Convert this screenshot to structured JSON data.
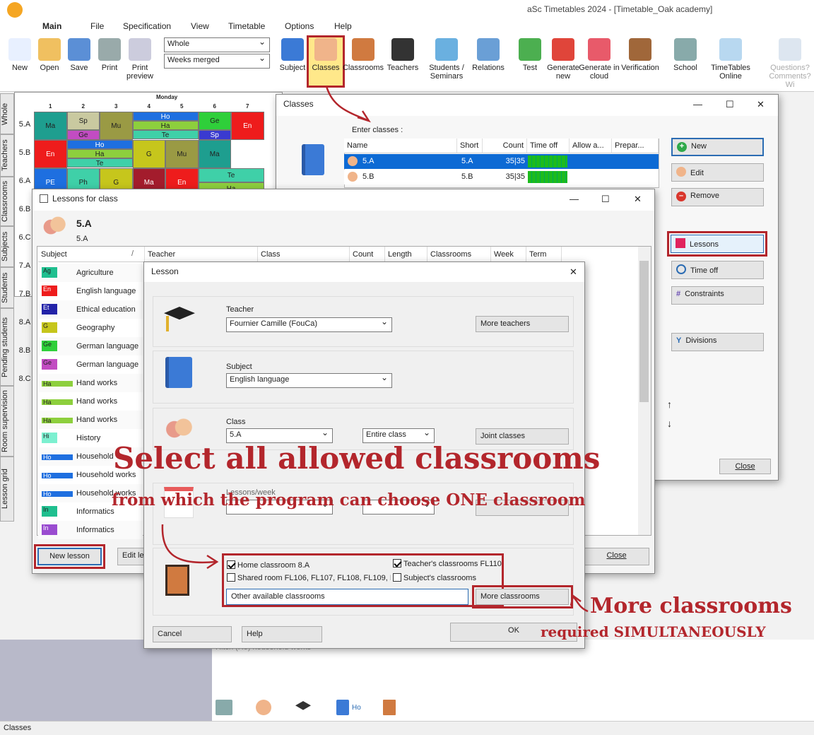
{
  "app": {
    "title": "aSc Timetables 2024 - [Timetable_Oak academy]",
    "statusbar": "Classes",
    "colors": {
      "accent": "#2b6cb3",
      "highlight": "#b3262c"
    }
  },
  "menu": [
    "Main",
    "File",
    "Specification",
    "View",
    "Timetable",
    "Options",
    "Help"
  ],
  "toolbar": {
    "new": "New",
    "open": "Open",
    "save": "Save",
    "print": "Print",
    "print_preview": "Print preview",
    "view_select": "Whole",
    "weeks_select": "Weeks merged",
    "subject": "Subject",
    "classes": "Classes",
    "classrooms": "Classrooms",
    "teachers": "Teachers",
    "students": "Students / Seminars",
    "relations": "Relations",
    "test": "Test",
    "generate_new": "Generate new",
    "generate_cloud": "Generate in cloud",
    "verification": "Verification",
    "school": "School",
    "timetables_online": "TimeTables Online",
    "questions": "Questions? Comments? Wi"
  },
  "side_tabs": [
    "Whole",
    "Teachers",
    "Classrooms",
    "Subjects",
    "Students",
    "Pending students",
    "Room supervision",
    "Lesson grid"
  ],
  "grid": {
    "day": "Monday",
    "periods": [
      "1",
      "2",
      "3",
      "4",
      "5",
      "6",
      "7"
    ],
    "rows": [
      "5.A",
      "5.B",
      "6.A",
      "6.B",
      "6.C",
      "7.A",
      "7.B",
      "8.A",
      "8.B",
      "8.C"
    ],
    "cells": [
      {
        "r": 0,
        "p": 0,
        "t": "Ma",
        "c": "#1e9e8f"
      },
      {
        "r": 0,
        "p": 1,
        "t": "Sp",
        "c": "#c9c9a0"
      },
      {
        "r": 0,
        "p": 1,
        "t": "Ge",
        "c": "#c24cc2",
        "b": 1
      },
      {
        "r": 0,
        "p": 2,
        "t": "Mu",
        "c": "#9a9a44"
      },
      {
        "r": 0,
        "p": 3,
        "t": "Ho",
        "c": "#1e6fe0"
      },
      {
        "r": 0,
        "p": 3,
        "t": "Ha",
        "c": "#8dcf3d",
        "m": 1
      },
      {
        "r": 0,
        "p": 3,
        "t": "Te",
        "c": "#3fd0a8",
        "b": 1
      },
      {
        "r": 0,
        "p": 5,
        "t": "Ge",
        "c": "#2fcf3a"
      },
      {
        "r": 0,
        "p": 5,
        "t": "Sp",
        "c": "#3a3ad0",
        "b": 1
      },
      {
        "r": 0,
        "p": 6,
        "t": "En",
        "c": "#ee1c1c"
      },
      {
        "r": 1,
        "p": 0,
        "t": "En",
        "c": "#ee1c1c"
      },
      {
        "r": 1,
        "p": 1,
        "t": "Ho",
        "c": "#1e6fe0"
      },
      {
        "r": 1,
        "p": 1,
        "t": "Ha",
        "c": "#8dcf3d",
        "m": 1
      },
      {
        "r": 1,
        "p": 1,
        "t": "Te",
        "c": "#3fd0a8",
        "b": 1
      },
      {
        "r": 1,
        "p": 3,
        "t": "G",
        "c": "#c6c61c"
      },
      {
        "r": 1,
        "p": 4,
        "t": "Mu",
        "c": "#9a9a44"
      },
      {
        "r": 1,
        "p": 5,
        "t": "Ma",
        "c": "#1e9e8f"
      },
      {
        "r": 2,
        "p": 0,
        "t": "PE",
        "c": "#1e6fe0"
      },
      {
        "r": 2,
        "p": 1,
        "t": "Ph",
        "c": "#3fd0a8"
      },
      {
        "r": 2,
        "p": 2,
        "t": "G",
        "c": "#c6c61c"
      },
      {
        "r": 2,
        "p": 3,
        "t": "Ma",
        "c": "#a31c2c"
      },
      {
        "r": 2,
        "p": 4,
        "t": "En",
        "c": "#ee1c1c"
      },
      {
        "r": 2,
        "p": 5,
        "t": "Te",
        "c": "#3fd0a8"
      },
      {
        "r": 2,
        "p": 5,
        "t": "Ha",
        "c": "#8dcf3d",
        "b": 1
      }
    ]
  },
  "classes_window": {
    "title": "Classes",
    "enter_label": "Enter classes :",
    "columns": [
      "Name",
      "Short",
      "Count",
      "Time off",
      "Allow a...",
      "Prepar..."
    ],
    "rows": [
      {
        "name": "5.A",
        "short": "5.A",
        "count": "35|35"
      },
      {
        "name": "5.B",
        "short": "5.B",
        "count": "35|35"
      }
    ],
    "buttons": {
      "new": "New",
      "edit": "Edit",
      "remove": "Remove",
      "lessons": "Lessons",
      "time_off": "Time off",
      "constraints": "Constraints",
      "divisions": "Divisions",
      "close": "Close"
    }
  },
  "lessons_window": {
    "title": "Lessons for class",
    "class_name": "5.A",
    "class_short": "5.A",
    "columns": [
      "Subject",
      "Teacher",
      "Class",
      "Count",
      "Length",
      "Classrooms",
      "Week",
      "Term"
    ],
    "subjects": [
      {
        "abbr": "Ag",
        "name": "Agriculture",
        "c": "#1fbf8f"
      },
      {
        "abbr": "En",
        "name": "English language",
        "c": "#ee1c1c"
      },
      {
        "abbr": "Et",
        "name": "Ethical education",
        "c": "#2323a8"
      },
      {
        "abbr": "G",
        "name": "Geography",
        "c": "#c6c61c"
      },
      {
        "abbr": "Ge",
        "name": "German language",
        "c": "#2fcf3a"
      },
      {
        "abbr": "Ge",
        "name": "German language",
        "c": "#c24cc2"
      },
      {
        "abbr": "Ha",
        "name": "Hand works",
        "c": "#8dcf3d"
      },
      {
        "abbr": "Ha",
        "name": "Hand works",
        "c": "#8dcf3d"
      },
      {
        "abbr": "Ha",
        "name": "Hand works",
        "c": "#8dcf3d"
      },
      {
        "abbr": "Hi",
        "name": "History",
        "c": "#7cf0d0"
      },
      {
        "abbr": "Ho",
        "name": "Household",
        "c": "#1e6fe0"
      },
      {
        "abbr": "Ho",
        "name": "Household works",
        "c": "#1e6fe0"
      },
      {
        "abbr": "Ho",
        "name": "Household works",
        "c": "#1e6fe0"
      },
      {
        "abbr": "In",
        "name": "Informatics",
        "c": "#1fbf8f"
      },
      {
        "abbr": "In",
        "name": "Informatics",
        "c": "#9a4cd0"
      }
    ],
    "buttons": {
      "new_lesson": "New lesson",
      "edit_lesson": "Edit le",
      "close": "Close"
    }
  },
  "lesson_dialog": {
    "title": "Lesson",
    "teacher_label": "Teacher",
    "teacher_value": "Fournier Camille (FouCa)",
    "more_teachers": "More teachers",
    "subject_label": "Subject",
    "subject_value": "English language",
    "class_label": "Class",
    "class_value": "5.A",
    "group_value": "Entire class",
    "joint_classes": "Joint classes",
    "lessons_week_label": "Lessons/week",
    "home_classroom": "Home classroom 8.A",
    "teachers_classrooms": "Teacher's classrooms FL110",
    "shared_room": "Shared room FL106, FL107, FL108, FL109, Fl",
    "subjects_classrooms": "Subject's classrooms",
    "other_classrooms": "Other available classrooms",
    "more_classrooms": "More classrooms",
    "cancel": "Cancel",
    "help": "Help",
    "ok": "OK"
  },
  "callouts": {
    "line1": "Select all allowed classrooms",
    "line2": "from which the program can choose ONE classroom",
    "line3": "More classrooms",
    "line4": "required SIMULTANEOUSLY"
  },
  "bottom": {
    "faded_text": "Hitch (Ho) household works",
    "ho_label": "Ho"
  }
}
